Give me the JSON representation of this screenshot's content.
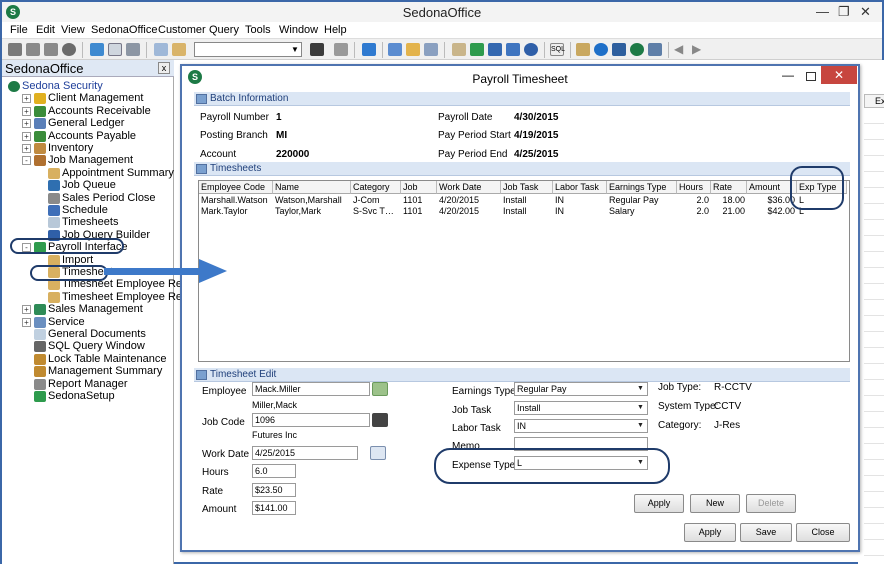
{
  "app": {
    "title": "SedonaOffice",
    "menus": [
      "File",
      "Edit",
      "View",
      "SedonaOffice",
      "Customer",
      "Query",
      "Tools",
      "Window",
      "Help"
    ]
  },
  "nav": {
    "title": "SedonaOffice",
    "close": "x",
    "items": [
      {
        "label": "Sedona Security",
        "expander": "",
        "link": true
      },
      {
        "label": "Client Management",
        "expander": "+"
      },
      {
        "label": "Accounts Receivable",
        "expander": "+"
      },
      {
        "label": "General Ledger",
        "expander": "+"
      },
      {
        "label": "Accounts Payable",
        "expander": "+"
      },
      {
        "label": "Inventory",
        "expander": "+"
      },
      {
        "label": "Job Management",
        "expander": "-"
      },
      {
        "label": "Appointment Summary",
        "expander": ""
      },
      {
        "label": "Job Queue",
        "expander": ""
      },
      {
        "label": "Sales Period Close",
        "expander": ""
      },
      {
        "label": "Schedule",
        "expander": ""
      },
      {
        "label": "Timesheets",
        "expander": ""
      },
      {
        "label": "Job Query Builder",
        "expander": ""
      },
      {
        "label": "Payroll Interface",
        "expander": "-"
      },
      {
        "label": "Import",
        "expander": ""
      },
      {
        "label": "Timesheets",
        "expander": ""
      },
      {
        "label": "Timesheet Employee Reco",
        "expander": ""
      },
      {
        "label": "Timesheet Employee Regis",
        "expander": ""
      },
      {
        "label": "Sales Management",
        "expander": "+"
      },
      {
        "label": "Service",
        "expander": "+"
      },
      {
        "label": "General Documents",
        "expander": ""
      },
      {
        "label": "SQL Query Window",
        "expander": ""
      },
      {
        "label": "Lock Table Maintenance",
        "expander": ""
      },
      {
        "label": "Management Summary",
        "expander": ""
      },
      {
        "label": "Report Manager",
        "expander": ""
      },
      {
        "label": "SedonaSetup",
        "expander": ""
      }
    ]
  },
  "dialog": {
    "title": "Payroll Timesheet",
    "batch": {
      "header": "Batch Information",
      "payroll_number_label": "Payroll Number",
      "payroll_number": "1",
      "posting_branch_label": "Posting Branch",
      "posting_branch": "MI",
      "account_label": "Account",
      "account": "220000",
      "payroll_date_label": "Payroll Date",
      "payroll_date": "4/30/2015",
      "period_start_label": "Pay Period Start",
      "period_start": "4/19/2015",
      "period_end_label": "Pay Period End",
      "period_end": "4/25/2015"
    },
    "timesheets": {
      "header": "Timesheets",
      "columns": [
        "Employee Code",
        "Name",
        "Category",
        "Job",
        "Work Date",
        "Job Task",
        "Labor Task",
        "Earnings Type",
        "Hours",
        "Rate",
        "Amount",
        "Exp Type"
      ],
      "rows": [
        [
          "Marshall.Watson",
          "Watson,Marshall",
          "J-Com",
          "1101",
          "4/20/2015",
          "Install",
          "IN",
          "Regular Pay",
          "2.0",
          "18.00",
          "$36.00",
          "L"
        ],
        [
          "Mark.Taylor",
          "Taylor,Mark",
          "S-Svc T…",
          "1101",
          "4/20/2015",
          "Install",
          "IN",
          "Salary",
          "2.0",
          "21.00",
          "$42.00",
          "L"
        ]
      ]
    },
    "edit": {
      "header": "Timesheet Edit",
      "employee_label": "Employee",
      "employee": "Mack.Miller",
      "employee_name": "Miller,Mack",
      "job_code_label": "Job Code",
      "job_code": "1096",
      "job_customer": "Futures  Inc",
      "work_date_label": "Work Date",
      "work_date": "4/25/2015",
      "hours_label": "Hours",
      "hours": "6.0",
      "rate_label": "Rate",
      "rate": "$23.50",
      "amount_label": "Amount",
      "amount": "$141.00",
      "earnings_type_label": "Earnings Type",
      "earnings_type": "Regular Pay",
      "job_task_label": "Job Task",
      "job_task": "Install",
      "labor_task_label": "Labor Task",
      "labor_task": "IN",
      "memo_label": "Memo",
      "memo": "",
      "expense_type_label": "Expense Type",
      "expense_type": "L",
      "job_type_label": "Job Type:",
      "job_type": "R-CCTV",
      "system_type_label": "System Type:",
      "system_type": "CCTV",
      "category_label": "Category:",
      "category": "J-Res",
      "apply": "Apply",
      "new": "New",
      "delete": "Delete"
    },
    "buttons": {
      "apply": "Apply",
      "save": "Save",
      "close": "Close"
    }
  },
  "background": {
    "exp_header_fragment": "Ex"
  }
}
